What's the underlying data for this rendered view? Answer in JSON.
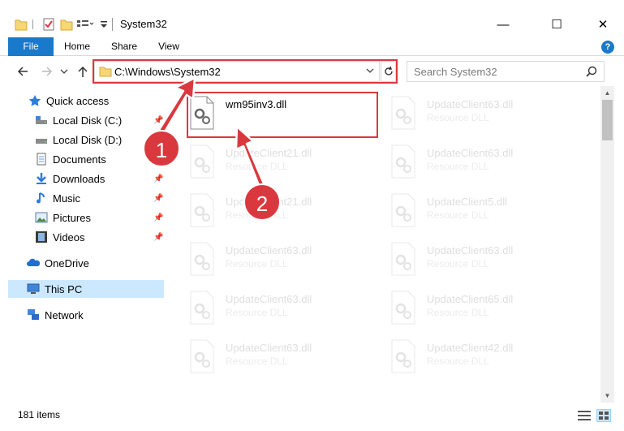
{
  "window": {
    "title": "System32",
    "minimize": "—",
    "maximize": "☐",
    "close": "✕"
  },
  "ribbon": {
    "tabs": [
      "File",
      "Home",
      "Share",
      "View"
    ],
    "help": "?"
  },
  "address": {
    "path": "C:\\Windows\\System32",
    "search_placeholder": "Search System32"
  },
  "nav": {
    "items": [
      {
        "label": "Quick access",
        "icon": "star-icon"
      },
      {
        "label": "Local Disk (C:)",
        "icon": "drive-icon",
        "pinned": true
      },
      {
        "label": "Local Disk (D:)",
        "icon": "drive-icon"
      },
      {
        "label": "Documents",
        "icon": "documents-icon"
      },
      {
        "label": "Downloads",
        "icon": "downloads-icon",
        "pinned": true
      },
      {
        "label": "Music",
        "icon": "music-icon",
        "pinned": true
      },
      {
        "label": "Pictures",
        "icon": "pictures-icon",
        "pinned": true
      },
      {
        "label": "Videos",
        "icon": "videos-icon",
        "pinned": true
      },
      {
        "label": "OneDrive",
        "icon": "onedrive-icon"
      },
      {
        "label": "This PC",
        "icon": "this-pc-icon",
        "selected": true
      },
      {
        "label": "Network",
        "icon": "network-icon"
      }
    ]
  },
  "files": [
    {
      "name": "wm95inv3.dll",
      "type": "",
      "highlighted": true
    },
    {
      "name": "UpdateClient63.dll",
      "type": "Resource DLL"
    },
    {
      "name": "UpdateClient21.dll",
      "type": "Resource DLL"
    },
    {
      "name": "UpdateClient63.dll",
      "type": "Resource DLL"
    },
    {
      "name": "UpdateClient21.dll",
      "type": "Resource DLL"
    },
    {
      "name": "UpdateClient5.dll",
      "type": "Resource DLL"
    },
    {
      "name": "UpdateClient63.dll",
      "type": "Resource DLL"
    },
    {
      "name": "UpdateClient63.dll",
      "type": "Resource DLL"
    },
    {
      "name": "UpdateClient63.dll",
      "type": "Resource DLL"
    },
    {
      "name": "UpdateClient65.dll",
      "type": "Resource DLL"
    },
    {
      "name": "UpdateClient63.dll",
      "type": "Resource DLL"
    },
    {
      "name": "UpdateClient42.dll",
      "type": "Resource DLL"
    }
  ],
  "status": {
    "count": "181 items"
  },
  "callouts": [
    "1",
    "2"
  ],
  "colors": {
    "accent": "#1979ca",
    "highlight": "#d9393e",
    "selected_bg": "#cce8ff"
  }
}
